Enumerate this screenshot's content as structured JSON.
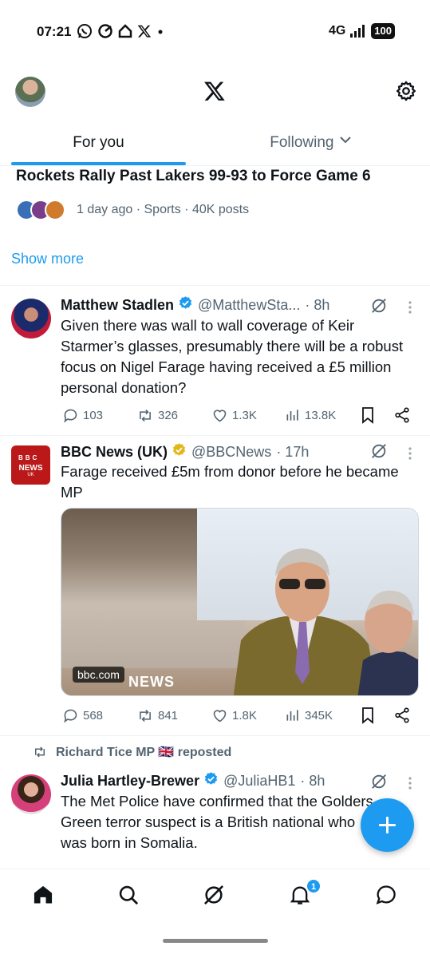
{
  "status_bar": {
    "time": "07:21",
    "network": "4G",
    "battery": "100"
  },
  "header": {
    "logo": "x-logo-icon"
  },
  "tabs": [
    {
      "label": "For you",
      "active": true
    },
    {
      "label": "Following",
      "active": false
    }
  ],
  "trend": {
    "title": "Rockets Rally Past Lakers 99-93 to Force Game 6",
    "meta": "1 day ago · Sports · 40K posts"
  },
  "show_more": "Show more",
  "tweets": [
    {
      "name": "Matthew Stadlen",
      "handle": "@MatthewSta...",
      "time": "· 8h",
      "text": "Given there was wall to wall coverage of Keir Starmer’s glasses, presumably there will be a robust focus on Nigel Farage having received a £5 million personal donation?",
      "replies": "103",
      "reposts": "326",
      "likes": "1.3K",
      "views": "13.8K"
    },
    {
      "name": "BBC News (UK)",
      "handle": "@BBCNews",
      "time": "· 17h",
      "text": "Farage received £5m from donor before he became MP",
      "media_watermark": "bbc.com",
      "media_brand": "NEWS",
      "avatar_text": [
        "BBC",
        "NEWS",
        "UK"
      ],
      "replies": "568",
      "reposts": "841",
      "likes": "1.8K",
      "views": "345K"
    },
    {
      "reposted_by": "Richard Tice MP 🇬🇧 reposted",
      "name": "Julia Hartley-Brewer",
      "handle": "@JuliaHB1",
      "time": "· 8h",
      "text": "The Met Police have confirmed that the Golders Green terror suspect is a British national who was born in Somalia."
    }
  ],
  "bottom_nav": {
    "notifications_badge": "1"
  },
  "colors": {
    "accent": "#1d9bf0",
    "text": "#0f1419",
    "muted": "#536471",
    "bbc_red": "#bb1919",
    "gold_check": "#e2b719"
  }
}
